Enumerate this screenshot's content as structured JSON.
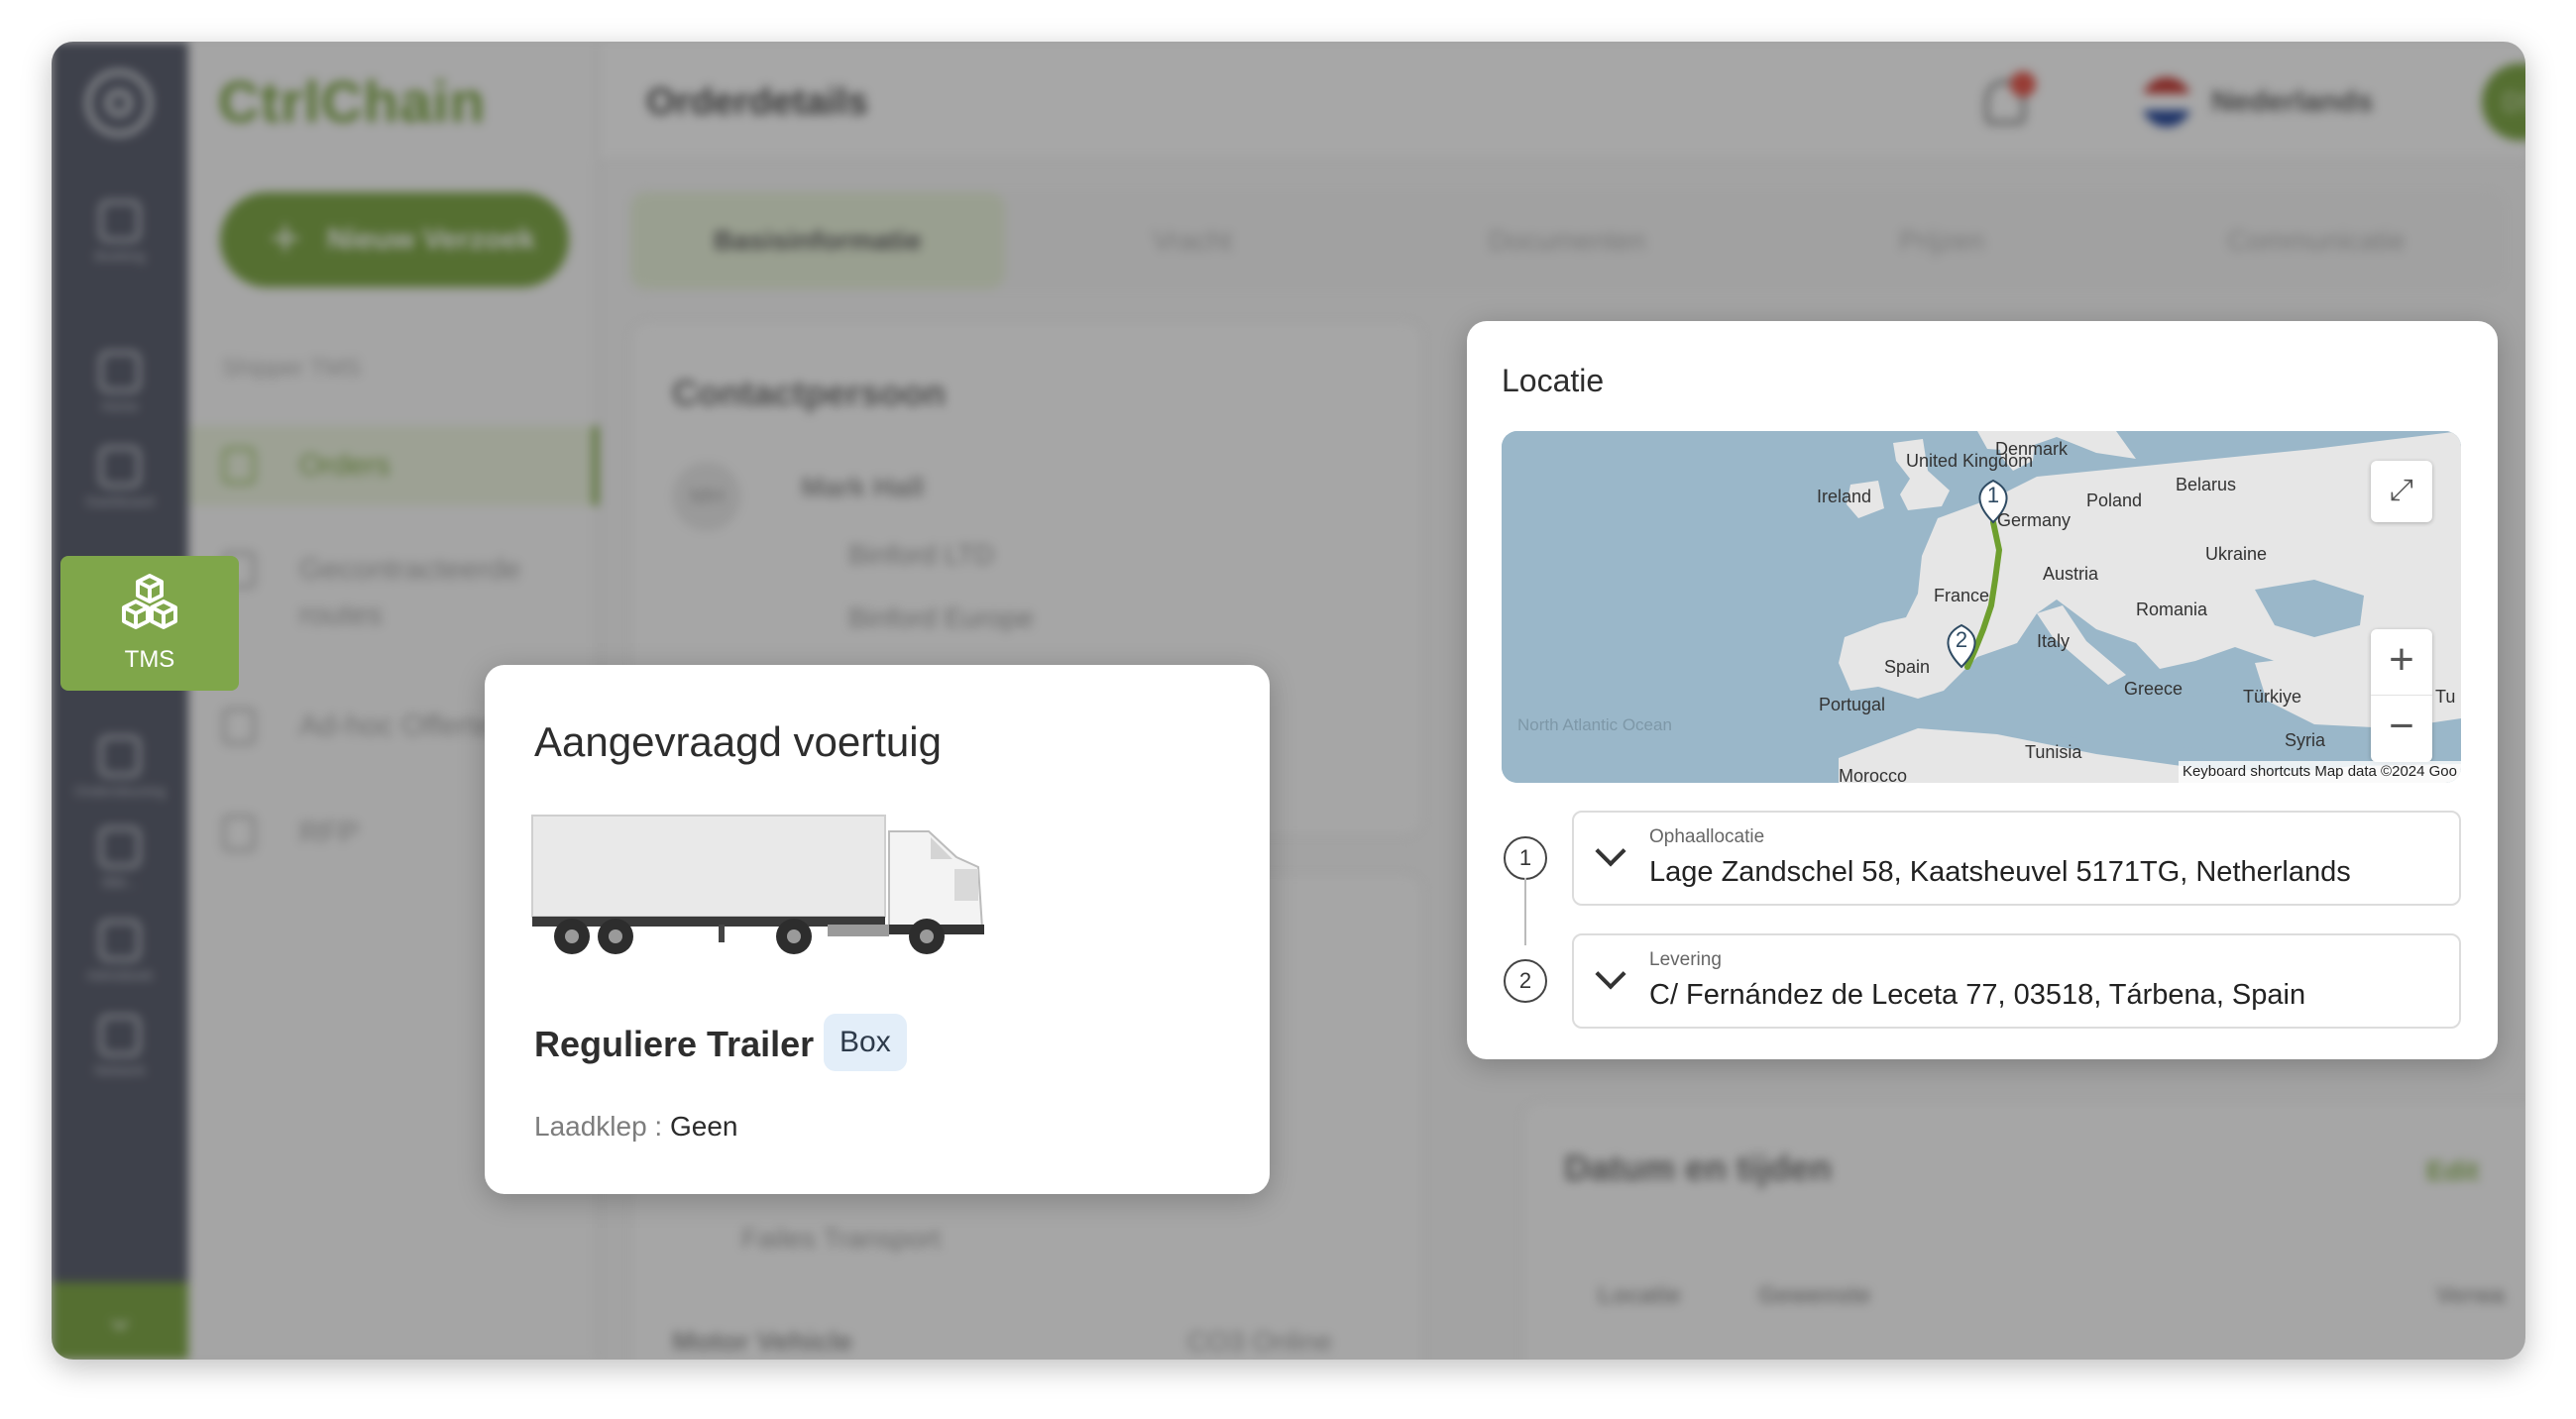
{
  "app": {
    "brand": "CtrlChain",
    "page_title": "Orderdetails",
    "language": "Nederlands",
    "avatar_initials": "DS"
  },
  "rail": {
    "items": [
      {
        "label": "Boeking",
        "icon": "clipboard-icon"
      },
      {
        "label": "Home",
        "icon": "home-icon"
      },
      {
        "label": "Dashboard",
        "icon": "chart-pie-icon"
      },
      {
        "label": "TMS",
        "icon": "cubes-icon"
      },
      {
        "label": "Ondersteuning",
        "icon": "document-icon"
      },
      {
        "label": "Bibl...",
        "icon": "file-icon"
      },
      {
        "label": "Adresboek",
        "icon": "book-icon"
      },
      {
        "label": "Netwerk",
        "icon": "gear-icon"
      }
    ],
    "active_label": "TMS"
  },
  "sidebar": {
    "new_button": "Nieuw Verzoek",
    "section": "Shipper TMS",
    "items": [
      "Orders",
      "Gecontracteerde routes",
      "Ad-hoc Offerte",
      "RFP"
    ]
  },
  "tabs": [
    "Basisinformatie",
    "Vracht",
    "Documenten",
    "Prijzen",
    "Communicatie"
  ],
  "background": {
    "contact_title": "Contactpersoon",
    "contact_initials": "MH",
    "contact_name": "Mark Hall",
    "company_1": "Binford LTD",
    "company_2": "Binford Europe",
    "transport": "Failes Transport",
    "vehicle": "Motor Vehicle",
    "vehicle_status": "CO3 Online",
    "dates_title": "Datum en tijden",
    "edit": "Edit",
    "col_locatie": "Locatie",
    "col_gewenste": "Gewenste",
    "col_verwacht": "Verwa"
  },
  "vehicle_modal": {
    "title": "Aangevraagd voertuig",
    "type": "Reguliere Trailer",
    "badge": "Box",
    "tailgate_label": "Laadklep",
    "tailgate_sep": " : ",
    "tailgate_value": "Geen"
  },
  "location_modal": {
    "title": "Locatie",
    "stops": [
      {
        "number": "1",
        "label": "Ophaallocatie",
        "address": "Lage Zandschel 58, Kaatsheuvel 5171TG, Netherlands"
      },
      {
        "number": "2",
        "label": "Levering",
        "address": "C/ Fernández de Leceta 77, 03518, Tárbena, Spain"
      }
    ],
    "map": {
      "labels": {
        "uk": "United Kingdom",
        "ireland": "Ireland",
        "denmark": "Denmark",
        "belarus": "Belarus",
        "poland": "Poland",
        "germany": "Germany",
        "ukraine": "Ukraine",
        "austria": "Austria",
        "france": "France",
        "romania": "Romania",
        "italy": "Italy",
        "spain": "Spain",
        "portugal": "Portugal",
        "greece": "Greece",
        "turkiye": "Türkiye",
        "tu": "Tu",
        "syria": "Syria",
        "tunisia": "Tunisia",
        "morocco": "Morocco",
        "ocean": "North Atlantic Ocean"
      },
      "attribution": "Keyboard shortcuts    Map data ©2024 Goo",
      "route_color": "#6e9f2e",
      "pin_color": "#2f4b63"
    }
  }
}
